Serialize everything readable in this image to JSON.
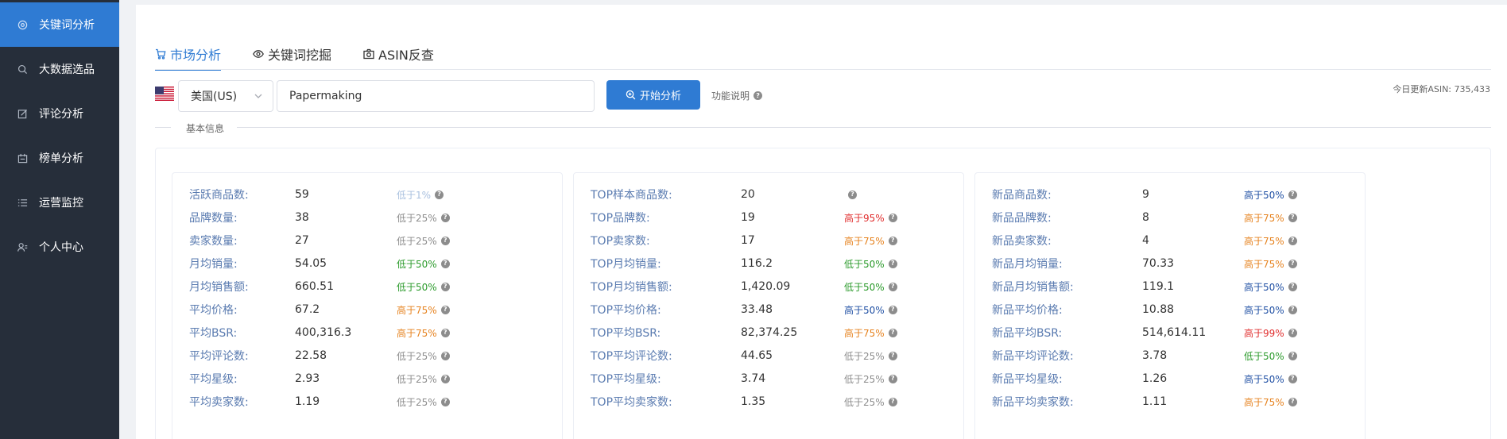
{
  "sidebar": {
    "items": [
      {
        "label": "关键词分析",
        "icon": "target-icon",
        "active": true
      },
      {
        "label": "大数据选品",
        "icon": "search-icon",
        "active": false
      },
      {
        "label": "评论分析",
        "icon": "edit-icon",
        "active": false
      },
      {
        "label": "榜单分析",
        "icon": "calendar-icon",
        "active": false
      },
      {
        "label": "运营监控",
        "icon": "list-icon",
        "active": false
      },
      {
        "label": "个人中心",
        "icon": "user-icon",
        "active": false
      }
    ]
  },
  "tabs": [
    {
      "label": "市场分析",
      "icon": "cart-icon",
      "active": true
    },
    {
      "label": "关键词挖掘",
      "icon": "eye-icon",
      "active": false
    },
    {
      "label": "ASIN反查",
      "icon": "camera-icon",
      "active": false
    }
  ],
  "search": {
    "country": "美国(US)",
    "country_flag": "us-flag-icon",
    "keyword": "Papermaking",
    "start_label": "开始分析",
    "help_label": "功能说明",
    "update_text": "今日更新ASIN: 735,433"
  },
  "section": {
    "title": "基本信息"
  },
  "colors": {
    "accent": "#2f7bd3",
    "sidebar_bg": "#262e3a",
    "low_gray": "#8c8c8c",
    "low_green": "#2a9a2a",
    "high_orange": "#e6821e",
    "high_red": "#e02d2d",
    "high_blue": "#1f4fa3",
    "low_light": "#a9c0df"
  },
  "cards": [
    {
      "rows": [
        {
          "label": "活跃商品数:",
          "value": "59",
          "compare": "低于1%",
          "tone": "low_light"
        },
        {
          "label": "品牌数量:",
          "value": "38",
          "compare": "低于25%",
          "tone": "low_gray"
        },
        {
          "label": "卖家数量:",
          "value": "27",
          "compare": "低于25%",
          "tone": "low_gray"
        },
        {
          "label": "月均销量:",
          "value": "54.05",
          "compare": "低于50%",
          "tone": "low_green"
        },
        {
          "label": "月均销售额:",
          "value": "660.51",
          "compare": "低于50%",
          "tone": "low_green"
        },
        {
          "label": "平均价格:",
          "value": "67.2",
          "compare": "高于75%",
          "tone": "high_orange"
        },
        {
          "label": "平均BSR:",
          "value": "400,316.3",
          "compare": "高于75%",
          "tone": "high_orange"
        },
        {
          "label": "平均评论数:",
          "value": "22.58",
          "compare": "低于25%",
          "tone": "low_gray"
        },
        {
          "label": "平均星级:",
          "value": "2.93",
          "compare": "低于25%",
          "tone": "low_gray"
        },
        {
          "label": "平均卖家数:",
          "value": "1.19",
          "compare": "低于25%",
          "tone": "low_gray"
        }
      ]
    },
    {
      "rows": [
        {
          "label": "TOP样本商品数:",
          "value": "20",
          "compare": "",
          "tone": "low_gray"
        },
        {
          "label": "TOP品牌数:",
          "value": "19",
          "compare": "高于95%",
          "tone": "high_red"
        },
        {
          "label": "TOP卖家数:",
          "value": "17",
          "compare": "高于75%",
          "tone": "high_orange"
        },
        {
          "label": "TOP月均销量:",
          "value": "116.2",
          "compare": "低于50%",
          "tone": "low_green"
        },
        {
          "label": "TOP月均销售额:",
          "value": "1,420.09",
          "compare": "低于50%",
          "tone": "low_green"
        },
        {
          "label": "TOP平均价格:",
          "value": "33.48",
          "compare": "高于50%",
          "tone": "high_blue"
        },
        {
          "label": "TOP平均BSR:",
          "value": "82,374.25",
          "compare": "高于75%",
          "tone": "high_orange"
        },
        {
          "label": "TOP平均评论数:",
          "value": "44.65",
          "compare": "低于25%",
          "tone": "low_gray"
        },
        {
          "label": "TOP平均星级:",
          "value": "3.74",
          "compare": "低于25%",
          "tone": "low_gray"
        },
        {
          "label": "TOP平均卖家数:",
          "value": "1.35",
          "compare": "低于25%",
          "tone": "low_gray"
        }
      ]
    },
    {
      "rows": [
        {
          "label": "新品商品数:",
          "value": "9",
          "compare": "高于50%",
          "tone": "high_blue"
        },
        {
          "label": "新品品牌数:",
          "value": "8",
          "compare": "高于75%",
          "tone": "high_orange"
        },
        {
          "label": "新品卖家数:",
          "value": "4",
          "compare": "高于75%",
          "tone": "high_orange"
        },
        {
          "label": "新品月均销量:",
          "value": "70.33",
          "compare": "高于75%",
          "tone": "high_orange"
        },
        {
          "label": "新品月均销售额:",
          "value": "119.1",
          "compare": "高于50%",
          "tone": "high_blue"
        },
        {
          "label": "新品平均价格:",
          "value": "10.88",
          "compare": "高于50%",
          "tone": "high_blue"
        },
        {
          "label": "新品平均BSR:",
          "value": "514,614.11",
          "compare": "高于99%",
          "tone": "high_red"
        },
        {
          "label": "新品平均评论数:",
          "value": "3.78",
          "compare": "低于50%",
          "tone": "low_green"
        },
        {
          "label": "新品平均星级:",
          "value": "1.26",
          "compare": "高于50%",
          "tone": "high_blue"
        },
        {
          "label": "新品平均卖家数:",
          "value": "1.11",
          "compare": "高于75%",
          "tone": "high_orange"
        }
      ]
    }
  ]
}
